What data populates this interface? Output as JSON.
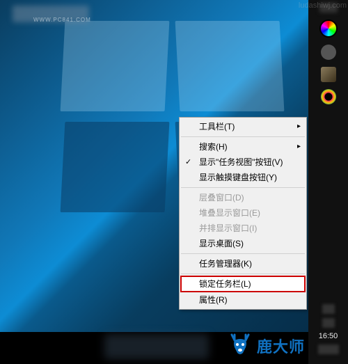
{
  "desktop": {
    "wallpaper_name": "windows-10-light"
  },
  "context_menu": {
    "items": [
      {
        "label": "工具栏(T)",
        "submenu": true,
        "checked": false,
        "enabled": true
      },
      {
        "sep": true
      },
      {
        "label": "搜索(H)",
        "submenu": true,
        "checked": false,
        "enabled": true
      },
      {
        "label": "显示\"任务视图\"按钮(V)",
        "submenu": false,
        "checked": true,
        "enabled": true
      },
      {
        "label": "显示触摸键盘按钮(Y)",
        "submenu": false,
        "checked": false,
        "enabled": true
      },
      {
        "sep": true
      },
      {
        "label": "层叠窗口(D)",
        "submenu": false,
        "checked": false,
        "enabled": false
      },
      {
        "label": "堆叠显示窗口(E)",
        "submenu": false,
        "checked": false,
        "enabled": false
      },
      {
        "label": "并排显示窗口(I)",
        "submenu": false,
        "checked": false,
        "enabled": false
      },
      {
        "label": "显示桌面(S)",
        "submenu": false,
        "checked": false,
        "enabled": true
      },
      {
        "sep": true
      },
      {
        "label": "任务管理器(K)",
        "submenu": false,
        "checked": false,
        "enabled": true
      },
      {
        "sep": true
      },
      {
        "label": "锁定任务栏(L)",
        "submenu": false,
        "checked": false,
        "enabled": true,
        "highlighted": true
      },
      {
        "label": "属性(R)",
        "submenu": false,
        "checked": false,
        "enabled": true
      }
    ]
  },
  "taskbar": {
    "clock_time": "16:50",
    "tray_icons": [
      "blurred",
      "color-wheel",
      "gray-dot",
      "avatar",
      "color-ring"
    ]
  },
  "watermark": {
    "top_left_url": "WWW.PC841.COM",
    "bottom_right_brand": "鹿大师",
    "corner_text": "ludashiwj.com"
  }
}
